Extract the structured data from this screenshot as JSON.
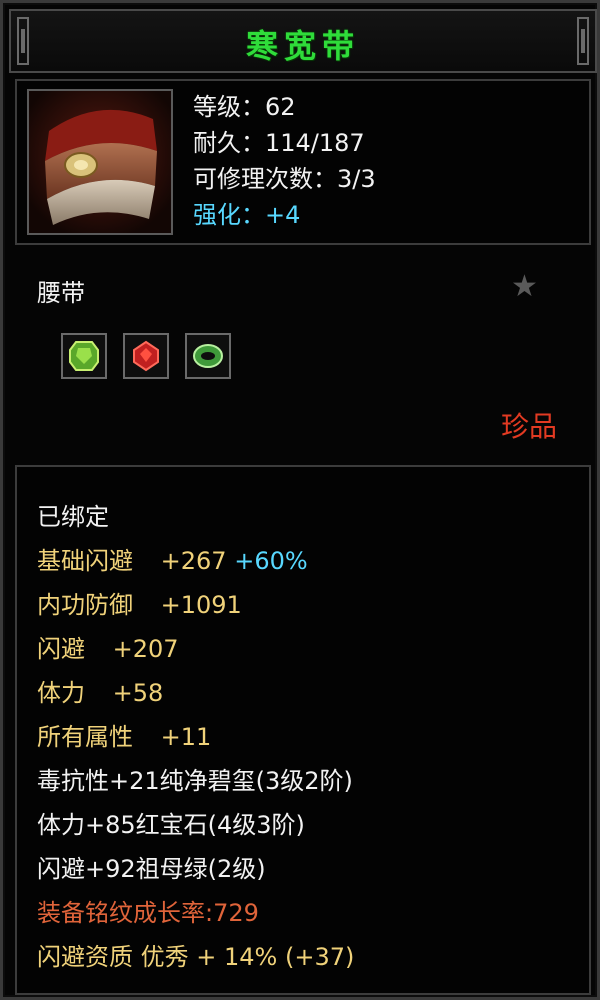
{
  "item": {
    "name": "寒宽带",
    "level": "等级：62",
    "durability": "耐久：114/187",
    "repairs": "可修理次数：3/3",
    "enhance": "强化：+4",
    "category": "腰带",
    "rarity": "珍品"
  },
  "gems": [
    {
      "name": "green-gem",
      "color": "#5aa82a"
    },
    {
      "name": "red-gem",
      "color": "#c02020"
    },
    {
      "name": "jade-ring",
      "color": "#3f9a3a"
    }
  ],
  "attributes": {
    "bound": "已绑定",
    "base_dodge_label": "基础闪避",
    "base_dodge_value": "+267",
    "base_dodge_bonus": "+60%",
    "inner_def_label": "内功防御",
    "inner_def_value": "+1091",
    "dodge_label": "闪避",
    "dodge_value": "+207",
    "stamina_label": "体力",
    "stamina_value": "+58",
    "all_attr_label": "所有属性",
    "all_attr_value": "+11",
    "gem_line1": "毒抗性+21纯净碧玺(3级2阶)",
    "gem_line2": "体力+85红宝石(4级3阶)",
    "gem_line3": "闪避+92祖母绿(2级)",
    "growth": "装备铭纹成长率:729",
    "quality": "闪避资质 优秀 + 14% (+37)"
  },
  "colors": {
    "title": "#2fdc3a",
    "enhance": "#58d8ff",
    "gold": "#f0d27a",
    "orange": "#e0643a",
    "rarity": "#e23a22"
  }
}
